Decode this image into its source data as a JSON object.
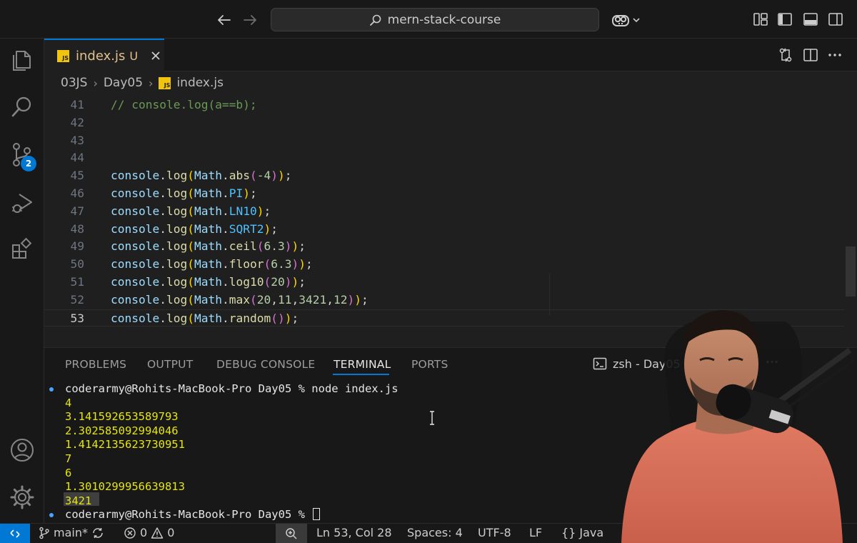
{
  "titlebar": {
    "search_text": "mern-stack-course",
    "icons": [
      "back-arrow-icon",
      "forward-arrow-icon",
      "search-icon",
      "copilot-icon",
      "chevron-down-icon",
      "customize-layout-icon",
      "toggle-sidebar-icon",
      "toggle-panel-icon",
      "toggle-secondary-sidebar-icon"
    ]
  },
  "activitybar": {
    "items": [
      "explorer",
      "search",
      "source-control",
      "run-and-debug",
      "extensions"
    ],
    "scm_badge": "2",
    "bottom": [
      "accounts",
      "manage"
    ]
  },
  "tab": {
    "filename": "index.js",
    "status": "U",
    "lang_badge": "JS"
  },
  "breadcrumb": {
    "parts": [
      "03JS",
      "Day05",
      "index.js"
    ]
  },
  "editor": {
    "current_line": 53,
    "lines": [
      {
        "n": "41",
        "tokens": [
          [
            "// console.log(a==b);",
            "com"
          ]
        ]
      },
      {
        "n": "42",
        "tokens": []
      },
      {
        "n": "43",
        "tokens": []
      },
      {
        "n": "44",
        "tokens": []
      },
      {
        "n": "45",
        "tokens": [
          [
            "console",
            "obj"
          ],
          [
            ".",
            "plain"
          ],
          [
            "log",
            "fn"
          ],
          [
            "(",
            "p1"
          ],
          [
            "Math",
            "obj"
          ],
          [
            ".",
            "plain"
          ],
          [
            "abs",
            "fn"
          ],
          [
            "(",
            "p2"
          ],
          [
            "-4",
            "num"
          ],
          [
            ")",
            "p2"
          ],
          [
            ")",
            "p1"
          ],
          [
            ";",
            "plain"
          ]
        ]
      },
      {
        "n": "46",
        "tokens": [
          [
            "console",
            "obj"
          ],
          [
            ".",
            "plain"
          ],
          [
            "log",
            "fn"
          ],
          [
            "(",
            "p1"
          ],
          [
            "Math",
            "obj"
          ],
          [
            ".",
            "plain"
          ],
          [
            "PI",
            "prop"
          ],
          [
            ")",
            "p1"
          ],
          [
            ";",
            "plain"
          ]
        ]
      },
      {
        "n": "47",
        "tokens": [
          [
            "console",
            "obj"
          ],
          [
            ".",
            "plain"
          ],
          [
            "log",
            "fn"
          ],
          [
            "(",
            "p1"
          ],
          [
            "Math",
            "obj"
          ],
          [
            ".",
            "plain"
          ],
          [
            "LN10",
            "prop"
          ],
          [
            ")",
            "p1"
          ],
          [
            ";",
            "plain"
          ]
        ]
      },
      {
        "n": "48",
        "tokens": [
          [
            "console",
            "obj"
          ],
          [
            ".",
            "plain"
          ],
          [
            "log",
            "fn"
          ],
          [
            "(",
            "p1"
          ],
          [
            "Math",
            "obj"
          ],
          [
            ".",
            "plain"
          ],
          [
            "SQRT2",
            "prop"
          ],
          [
            ")",
            "p1"
          ],
          [
            ";",
            "plain"
          ]
        ]
      },
      {
        "n": "49",
        "tokens": [
          [
            "console",
            "obj"
          ],
          [
            ".",
            "plain"
          ],
          [
            "log",
            "fn"
          ],
          [
            "(",
            "p1"
          ],
          [
            "Math",
            "obj"
          ],
          [
            ".",
            "plain"
          ],
          [
            "ceil",
            "fn"
          ],
          [
            "(",
            "p2"
          ],
          [
            "6.3",
            "num"
          ],
          [
            ")",
            "p2"
          ],
          [
            ")",
            "p1"
          ],
          [
            ";",
            "plain"
          ]
        ]
      },
      {
        "n": "50",
        "tokens": [
          [
            "console",
            "obj"
          ],
          [
            ".",
            "plain"
          ],
          [
            "log",
            "fn"
          ],
          [
            "(",
            "p1"
          ],
          [
            "Math",
            "obj"
          ],
          [
            ".",
            "plain"
          ],
          [
            "floor",
            "fn"
          ],
          [
            "(",
            "p2"
          ],
          [
            "6.3",
            "num"
          ],
          [
            ")",
            "p2"
          ],
          [
            ")",
            "p1"
          ],
          [
            ";",
            "plain"
          ]
        ]
      },
      {
        "n": "51",
        "tokens": [
          [
            "console",
            "obj"
          ],
          [
            ".",
            "plain"
          ],
          [
            "log",
            "fn"
          ],
          [
            "(",
            "p1"
          ],
          [
            "Math",
            "obj"
          ],
          [
            ".",
            "plain"
          ],
          [
            "log10",
            "fn"
          ],
          [
            "(",
            "p2"
          ],
          [
            "20",
            "num"
          ],
          [
            ")",
            "p2"
          ],
          [
            ")",
            "p1"
          ],
          [
            ";",
            "plain"
          ]
        ]
      },
      {
        "n": "52",
        "tokens": [
          [
            "console",
            "obj"
          ],
          [
            ".",
            "plain"
          ],
          [
            "log",
            "fn"
          ],
          [
            "(",
            "p1"
          ],
          [
            "Math",
            "obj"
          ],
          [
            ".",
            "plain"
          ],
          [
            "max",
            "fn"
          ],
          [
            "(",
            "p2"
          ],
          [
            "20",
            "num"
          ],
          [
            ",",
            "plain"
          ],
          [
            "11",
            "num"
          ],
          [
            ",",
            "plain"
          ],
          [
            "3421",
            "num"
          ],
          [
            ",",
            "plain"
          ],
          [
            "12",
            "num"
          ],
          [
            ")",
            "p2"
          ],
          [
            ")",
            "p1"
          ],
          [
            ";",
            "plain"
          ]
        ]
      },
      {
        "n": "53",
        "tokens": [
          [
            "console",
            "obj"
          ],
          [
            ".",
            "plain"
          ],
          [
            "log",
            "fn"
          ],
          [
            "(",
            "p1"
          ],
          [
            "Math",
            "obj"
          ],
          [
            ".",
            "plain"
          ],
          [
            "random",
            "fn"
          ],
          [
            "(",
            "p2"
          ],
          [
            ")",
            "p2"
          ],
          [
            ")",
            "p1"
          ],
          [
            ";",
            "plain"
          ]
        ]
      }
    ]
  },
  "panel": {
    "tabs": [
      "PROBLEMS",
      "OUTPUT",
      "DEBUG CONSOLE",
      "TERMINAL",
      "PORTS"
    ],
    "active_tab": "TERMINAL",
    "terminal_label": "zsh - Day05",
    "more_label": "···"
  },
  "terminal": {
    "prompt": "coderarmy@Rohits-MacBook-Pro Day05 %",
    "command": "node index.js",
    "outputs": [
      "4",
      "3.141592653589793",
      "2.302585092994046",
      "1.4142135623730951",
      "7",
      "6",
      "1.3010299956639813",
      "3421"
    ]
  },
  "statusbar": {
    "branch": "main*",
    "errors": "0",
    "warnings": "0",
    "position": "Ln 53, Col 28",
    "spaces": "Spaces: 4",
    "encoding": "UTF-8",
    "eol": "LF",
    "language": "Java",
    "language_braces": "{}"
  },
  "colors": {
    "accent": "#0078d4",
    "terminal_output": "#e5e510",
    "modified_file": "#e2c08d"
  }
}
